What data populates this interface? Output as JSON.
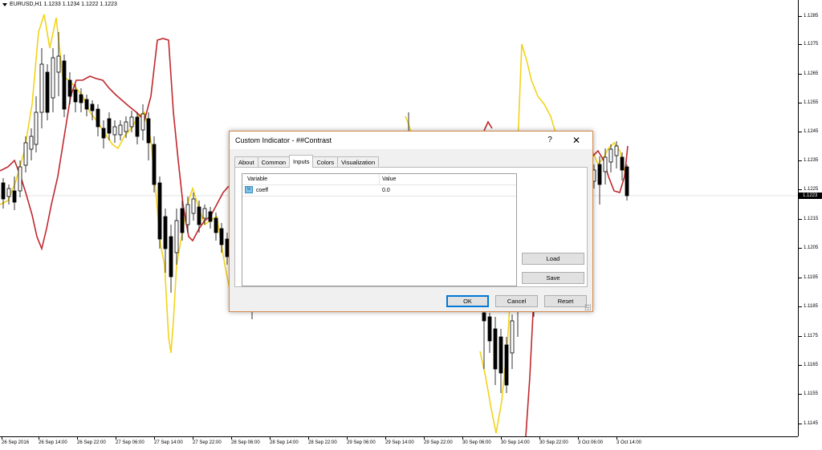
{
  "chart": {
    "header": "EURUSD,H1  1.1233 1.1234 1.1222 1.1223",
    "colors": {
      "bull": "#ffffff",
      "bear": "#000000",
      "fast_line": "#f2d31b",
      "slow_line": "#c0282d",
      "background": "#ffffff",
      "current_price_line": "#c8c8c8"
    },
    "current_price": "1.1223",
    "price_labels": [
      "1.1285",
      "1.1275",
      "1.1265",
      "1.1255",
      "1.1245",
      "1.1235",
      "1.1225",
      "1.1215",
      "1.1205",
      "1.1195",
      "1.1185",
      "1.1175",
      "1.1165",
      "1.1155",
      "1.1145"
    ],
    "time_labels": [
      "26 Sep 2016",
      "26 Sep 14:00",
      "26 Sep 22:00",
      "27 Sep 06:00",
      "27 Sep 14:00",
      "27 Sep 22:00",
      "28 Sep 06:00",
      "28 Sep 14:00",
      "28 Sep 22:00",
      "29 Sep 06:00",
      "29 Sep 14:00",
      "29 Sep 22:00",
      "30 Sep 06:00",
      "30 Sep 14:00",
      "30 Sep 22:00",
      "3 Oct 06:00",
      "3 Oct 14:00"
    ]
  },
  "dialog": {
    "title": "Custom Indicator - ##Contrast",
    "help_label": "?",
    "close_label": "✕",
    "tabs": [
      {
        "label": "About",
        "active": false
      },
      {
        "label": "Common",
        "active": false
      },
      {
        "label": "Inputs",
        "active": true
      },
      {
        "label": "Colors",
        "active": false
      },
      {
        "label": "Visualization",
        "active": false
      }
    ],
    "table": {
      "col_variable": "Variable",
      "col_value": "Value",
      "rows": [
        {
          "icon": "½",
          "name": "coeff",
          "value": "0.0"
        }
      ]
    },
    "buttons": {
      "load": "Load",
      "save": "Save",
      "ok": "OK",
      "cancel": "Cancel",
      "reset": "Reset"
    }
  }
}
